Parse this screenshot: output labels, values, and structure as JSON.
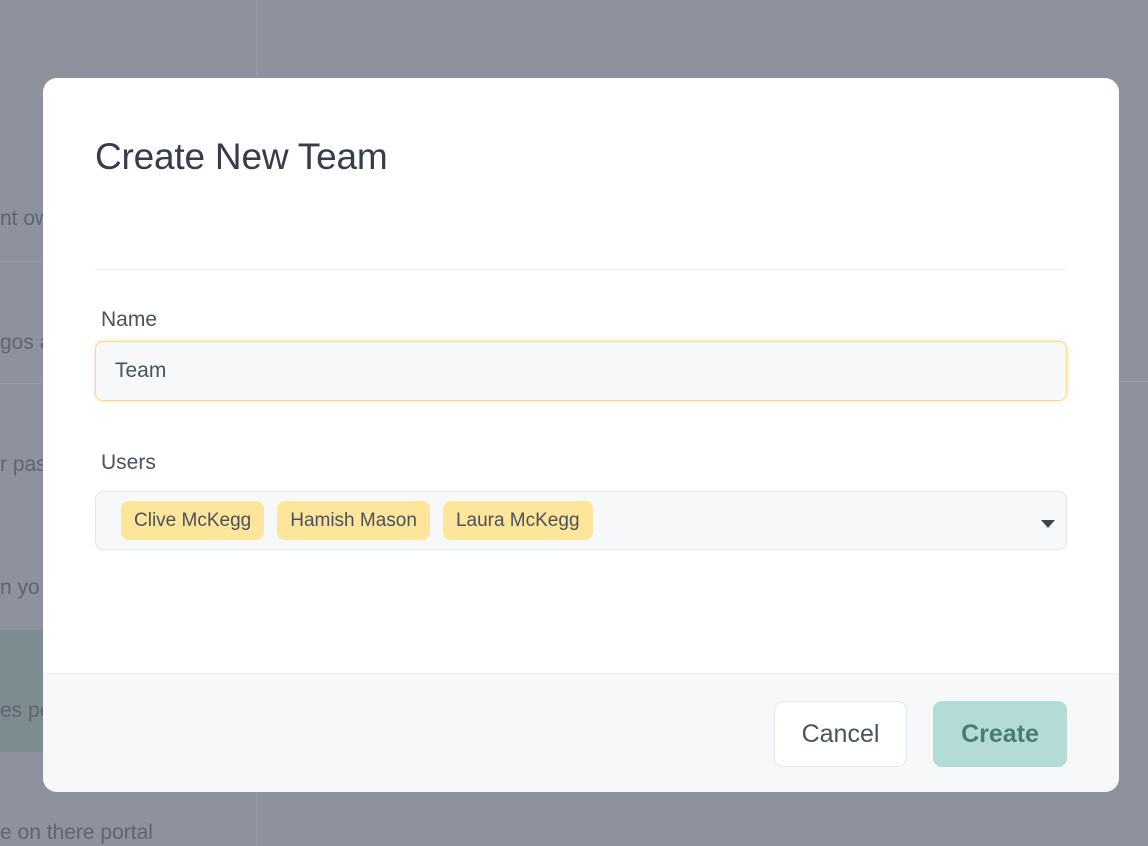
{
  "background": {
    "snippets": [
      "nt ow",
      "gos a",
      "r pas",
      "n yo",
      "es pe",
      "e on there portal"
    ]
  },
  "modal": {
    "title": "Create New Team",
    "name_label": "Name",
    "name_value": "Team",
    "users_label": "Users",
    "selected_users": [
      "Clive McKegg",
      "Hamish Mason",
      "Laura McKegg"
    ],
    "cancel_label": "Cancel",
    "create_label": "Create"
  },
  "colors": {
    "tag": "#fde59a",
    "create_button": "#b3dcd7",
    "input_focus_border": "#fad98c",
    "overlay": "#8e929c"
  },
  "icons": {
    "users_dropdown": "chevron-down-icon"
  }
}
